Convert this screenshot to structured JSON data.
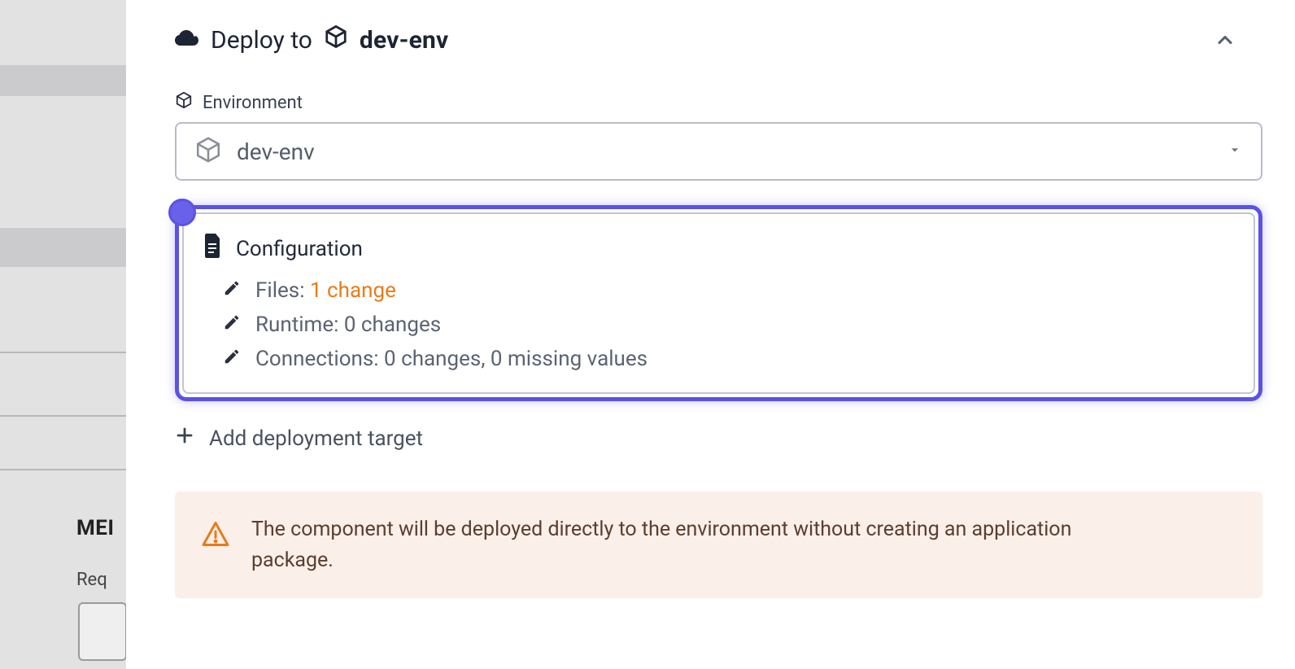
{
  "header": {
    "prefix": "Deploy to",
    "target": "dev-env"
  },
  "environment": {
    "label": "Environment",
    "selected": "dev-env"
  },
  "configuration": {
    "title": "Configuration",
    "rows": {
      "files_label": "Files:",
      "files_value": "1 change",
      "runtime": "Runtime: 0 changes",
      "connections": "Connections: 0 changes, 0 missing values"
    }
  },
  "add_target_label": "Add deployment target",
  "warning_text": "The component will be deployed directly to the environment without creating an application package.",
  "bg": {
    "mem": "MEI",
    "req": "Req"
  }
}
